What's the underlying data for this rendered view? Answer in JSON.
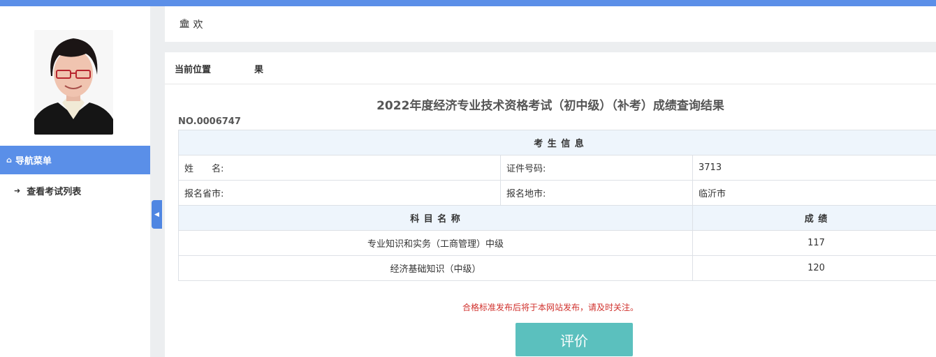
{
  "sidebar": {
    "nav_header_label": "导航菜单",
    "nav_header_icon": "home-icon",
    "items": [
      {
        "label": "查看考试列表",
        "icon": "sign-in-icon"
      }
    ]
  },
  "header": {
    "welcome_icon": "bank-icon",
    "welcome_text": "欢"
  },
  "breadcrumb": {
    "prefix": "当前位置",
    "suffix": "果"
  },
  "result": {
    "title": "2022年度经济专业技术资格考试（初中级）（补考）成绩查询结果",
    "cert_no": "NO.0006747",
    "candidate_header": "考 生 信 息",
    "name_label": "姓　　名:",
    "name_value": "",
    "id_label": "证件号码:",
    "id_value": "3713",
    "province_label": "报名省市:",
    "province_value": "",
    "city_label": "报名地市:",
    "city_value": "临沂市",
    "subject_header": "科 目 名 称",
    "score_header": "成 绩",
    "subjects": [
      {
        "name": "专业知识和实务（工商管理）中级",
        "score": "117"
      },
      {
        "name": "经济基础知识（中级）",
        "score": "120"
      }
    ]
  },
  "notice": "合格标准发布后将于本网站发布，请及时关注。",
  "rate_button_label": "评价",
  "colors": {
    "topbar": "#5b8fe8",
    "nav_active": "#5a8fe8",
    "table_header_bg": "#eef5fc",
    "notice": "#d0312d",
    "rate_button": "#5bc0be"
  }
}
